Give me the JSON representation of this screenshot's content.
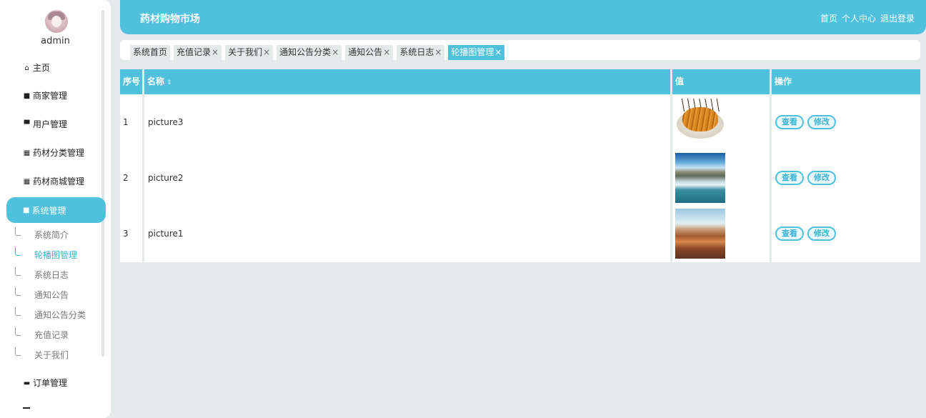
{
  "sidebar": {
    "username": "admin",
    "menu": [
      {
        "label": "主页",
        "icon": "home-icon"
      },
      {
        "label": "商家管理",
        "icon": "briefcase-icon"
      },
      {
        "label": "用户管理",
        "icon": "chat-icon"
      },
      {
        "label": "药材分类管理",
        "icon": "grid-icon"
      },
      {
        "label": "药材商城管理",
        "icon": "grid-icon"
      },
      {
        "label": "系统管理",
        "icon": "clipboard-icon"
      },
      {
        "label": "订单管理",
        "icon": "monitor-icon"
      }
    ],
    "submenu": [
      {
        "label": "系统简介"
      },
      {
        "label": "轮播图管理"
      },
      {
        "label": "系统日志"
      },
      {
        "label": "通知公告"
      },
      {
        "label": "通知公告分类"
      },
      {
        "label": "充值记录"
      },
      {
        "label": "关于我们"
      }
    ]
  },
  "header": {
    "title": "药材购物市场",
    "links": [
      "首页",
      "个人中心",
      "退出登录"
    ]
  },
  "tabs": [
    {
      "label": "系统首页",
      "closable": false
    },
    {
      "label": "充值记录",
      "closable": true
    },
    {
      "label": "关于我们",
      "closable": true
    },
    {
      "label": "通知公告分类",
      "closable": true
    },
    {
      "label": "通知公告",
      "closable": true
    },
    {
      "label": "系统日志",
      "closable": true
    },
    {
      "label": "轮播图管理",
      "closable": true
    }
  ],
  "close_glyph": "×",
  "table": {
    "headers": {
      "index": "序号",
      "name": "名称",
      "value": "值",
      "actions": "操作"
    },
    "sort_glyph": "⇕",
    "rows": [
      {
        "index": "1",
        "name": "picture3",
        "image": "cordyceps-image"
      },
      {
        "index": "2",
        "name": "picture2",
        "image": "waterfall-image"
      },
      {
        "index": "3",
        "name": "picture1",
        "image": "coast-image"
      }
    ],
    "buttons": {
      "view": "查看",
      "edit": "修改"
    }
  },
  "colors": {
    "accent": "#4fc1dd",
    "background": "#e4e9ea"
  }
}
